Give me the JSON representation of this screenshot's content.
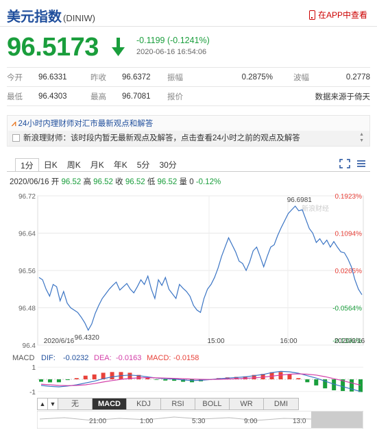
{
  "header": {
    "title": "美元指数",
    "code": "(DINIW)",
    "app_link": "在APP中查看",
    "price": "96.5173",
    "change": "-0.1199 (-0.1241%)",
    "timestamp": "2020-06-16 16:54:06"
  },
  "stats": {
    "rows": [
      [
        {
          "label": "今开",
          "value": "96.6331"
        },
        {
          "label": "昨收",
          "value": "96.6372"
        },
        {
          "label": "振幅",
          "value": "0.2875%"
        },
        {
          "label": "波幅",
          "value": "0.2778"
        }
      ],
      [
        {
          "label": "最低",
          "value": "96.4303"
        },
        {
          "label": "最高",
          "value": "96.7081"
        },
        {
          "label": "报价",
          "value": ""
        },
        {
          "label": "",
          "value": "数据来源于倚天"
        }
      ]
    ]
  },
  "news": {
    "headline": "24小时内理财师对汇市最新观点和解答",
    "message": "新浪理财师：该时段内暂无最新观点及解答，点击查看24小时之前的观点及解答"
  },
  "tabs": [
    "1分",
    "日K",
    "周K",
    "月K",
    "年K",
    "5分",
    "30分"
  ],
  "active_tab": "1分",
  "quote_line": {
    "date": "2020/06/16",
    "open_label": "开",
    "open": "96.52",
    "high_label": "高",
    "high": "96.52",
    "close_label": "收",
    "close": "96.52",
    "low_label": "低",
    "low": "96.52",
    "vol_label": "量",
    "vol": "0",
    "pct": "-0.12%"
  },
  "indicator_tabs": [
    "无",
    "MACD",
    "KDJ",
    "RSI",
    "BOLL",
    "WR",
    "DMI"
  ],
  "active_indicator": "MACD",
  "navigator_labels": [
    "21:00",
    "1:00",
    "5:30",
    "9:00",
    "13:0"
  ],
  "colors": {
    "up": "#e8423a",
    "down": "#1a9e3c",
    "line": "#3a74c4",
    "blue": "#1f4e9c"
  },
  "chart_data": [
    {
      "type": "line",
      "title": "",
      "x_tick_labels": [
        "2020/6/16",
        "15:00",
        "16:00",
        "2020/6/16"
      ],
      "ylim": [
        96.4,
        96.72
      ],
      "y_ticks": [
        96.72,
        96.64,
        96.56,
        96.48,
        96.4
      ],
      "right_ticks": [
        "0.1923%",
        "0.1094%",
        "0.0265%",
        "-0.0564%",
        "-0.1392%"
      ],
      "annotations": [
        {
          "text": "96.6981"
        },
        {
          "text": "96.4320"
        }
      ],
      "watermark": "新浪财经",
      "values": [
        96.545,
        96.54,
        96.52,
        96.505,
        96.53,
        96.525,
        96.495,
        96.515,
        96.49,
        96.48,
        96.475,
        96.47,
        96.46,
        96.448,
        96.432,
        96.445,
        96.468,
        96.485,
        96.5,
        96.51,
        96.52,
        96.528,
        96.535,
        96.518,
        96.525,
        96.532,
        96.52,
        96.512,
        96.525,
        96.54,
        96.53,
        96.548,
        96.52,
        96.5,
        96.54,
        96.528,
        96.545,
        96.52,
        96.51,
        96.5,
        96.53,
        96.522,
        96.515,
        96.505,
        96.485,
        96.475,
        96.47,
        96.5,
        96.52,
        96.53,
        96.545,
        96.565,
        96.59,
        96.61,
        96.63,
        96.615,
        96.6,
        96.58,
        96.575,
        96.56,
        96.578,
        96.602,
        96.61,
        96.59,
        96.568,
        96.59,
        96.61,
        96.615,
        96.635,
        96.652,
        96.667,
        96.682,
        96.69,
        96.698,
        96.688,
        96.69,
        96.67,
        96.65,
        96.64,
        96.62,
        96.628,
        96.616,
        96.625,
        96.61,
        96.622,
        96.61,
        96.6,
        96.598,
        96.585,
        96.568,
        96.54,
        96.52,
        96.508
      ]
    },
    {
      "type": "bar",
      "title": "MACD",
      "legend": [
        {
          "name": "DIF:",
          "value": "-0.0232"
        },
        {
          "name": "DEA:",
          "value": "-0.0163"
        },
        {
          "name": "MACD:",
          "value": "-0.0158"
        }
      ],
      "y_ticks": [
        1,
        -1
      ],
      "ylim": [
        -1.35,
        1.35
      ],
      "series": [
        {
          "name": "DIF",
          "values": [
            -0.5,
            -0.58,
            -0.62,
            -0.55,
            -0.45,
            -0.3,
            -0.15,
            0.05,
            0.2,
            0.3,
            0.35,
            0.3,
            0.2,
            0.1,
            0.05,
            0.02,
            -0.05,
            -0.1,
            -0.08,
            -0.02,
            0.05,
            0.1,
            0.15,
            0.2,
            0.3,
            0.4,
            0.55,
            0.65,
            0.62,
            0.5,
            0.3,
            0.1,
            -0.15,
            -0.4,
            -0.6,
            -0.8,
            -1.0
          ]
        },
        {
          "name": "DEA",
          "values": [
            -0.4,
            -0.45,
            -0.5,
            -0.52,
            -0.5,
            -0.45,
            -0.35,
            -0.22,
            -0.1,
            0.0,
            0.08,
            0.12,
            0.14,
            0.12,
            0.1,
            0.08,
            0.05,
            0.02,
            0.0,
            -0.01,
            0.0,
            0.02,
            0.05,
            0.08,
            0.12,
            0.18,
            0.26,
            0.35,
            0.42,
            0.45,
            0.42,
            0.35,
            0.22,
            0.05,
            -0.12,
            -0.3,
            -0.48
          ]
        },
        {
          "name": "MACD",
          "values": [
            -0.2,
            -0.25,
            -0.24,
            -0.06,
            0.1,
            0.3,
            0.4,
            0.54,
            0.6,
            0.6,
            0.54,
            0.36,
            0.12,
            -0.04,
            -0.1,
            -0.12,
            -0.2,
            -0.24,
            -0.16,
            -0.02,
            0.1,
            0.16,
            0.2,
            0.24,
            0.36,
            0.44,
            0.58,
            0.6,
            0.4,
            0.1,
            -0.24,
            -0.5,
            -0.74,
            -0.9,
            -0.96,
            -1.0,
            -1.04
          ]
        }
      ]
    }
  ]
}
